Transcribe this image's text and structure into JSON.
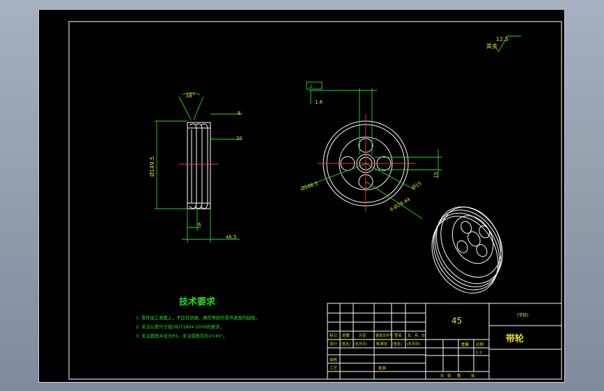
{
  "drawing": {
    "surface_finish": {
      "label": "其余",
      "value": "12.5"
    },
    "tech_requirements": {
      "title": "技术要求",
      "items": [
        "1. 零件加工表面上，不应有划痕、擦伤等损伤零件表面的缺陷。",
        "2. 未注公差尺寸按GB/T1804-2000的要求。",
        "3. 未注圆角半径为R5，未注倒角均为2×45°。"
      ]
    },
    "side_view_dims": {
      "groove_angle": "38°",
      "groove_top": "8",
      "groove_depth": "20",
      "outer_dia": "Ø149.5",
      "hub_width": "6",
      "total_width": "46.5"
    },
    "front_view_dims": {
      "flatness": "1.6",
      "outer_dia": "Ø166.5",
      "hole_dia": "Ø15",
      "holes": "4-Ø24.44",
      "keyway": "15"
    }
  },
  "title_block": {
    "material": "45",
    "school": "(学校)",
    "part_name": "带轮",
    "scale": "1:1",
    "header_cells": [
      "标记",
      "处数",
      "分区",
      "更改文件号",
      "签名",
      "年、月、日"
    ],
    "row_design": [
      "设计",
      "(签名)",
      "(年月日)",
      "标准化",
      "(签名)",
      "(年月日)"
    ],
    "row_review": "审核",
    "row_process": "工艺",
    "approve": "批准",
    "weight_label": "重量",
    "scale_label": "比例",
    "sheet_info": [
      "共",
      "张",
      "第",
      "张"
    ]
  }
}
